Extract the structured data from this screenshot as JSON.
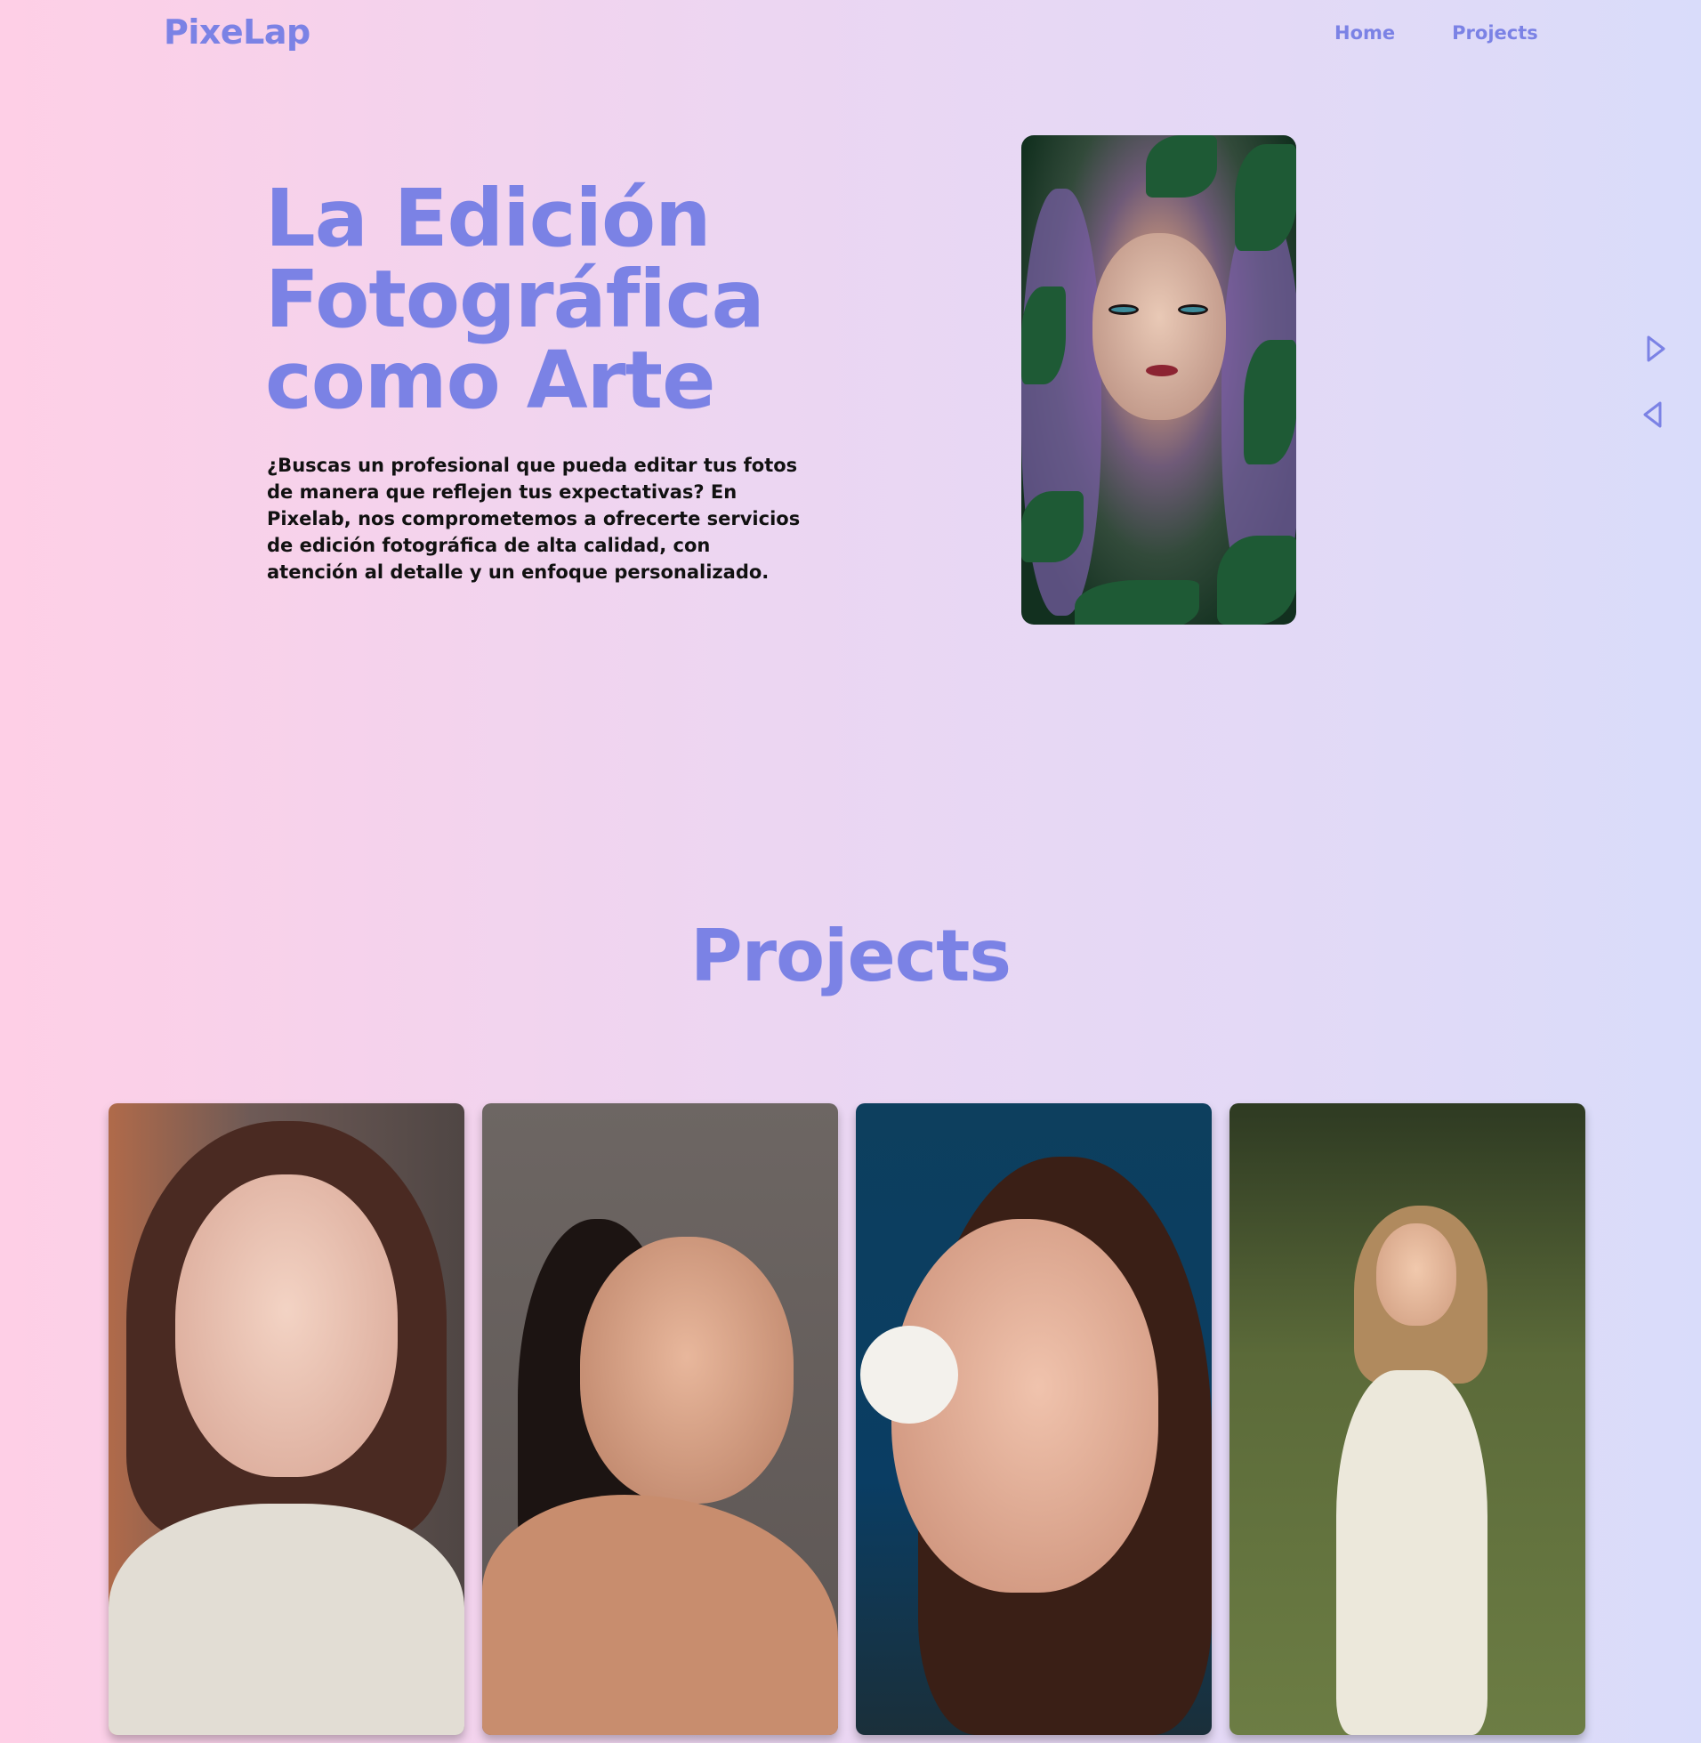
{
  "brand": {
    "logo": "PixeLap",
    "accent": "#7b82e5"
  },
  "nav": {
    "items": [
      {
        "label": "Home"
      },
      {
        "label": "Projects"
      }
    ]
  },
  "hero": {
    "title_lines": [
      "La Edición",
      "Fotográfica",
      "como Arte"
    ],
    "description": "¿Buscas un profesional que pueda editar tus fotos de manera que reflejen tus expectativas? En Pixelab, nos comprometemos a ofrecerte servicios de edición fotográfica de alta calidad, con atención al detalle y un enfoque personalizado.",
    "photo": "portrait-woman-purple-hair-leaves"
  },
  "carousel": {
    "next_icon": "triangle-right-icon",
    "prev_icon": "triangle-left-icon"
  },
  "projects": {
    "title": "Projects",
    "items": [
      {
        "photo": "portrait-woman-knit-sweater"
      },
      {
        "photo": "portrait-woman-eyes-closed"
      },
      {
        "photo": "portrait-woman-daisy-blue-background"
      },
      {
        "photo": "portrait-woman-white-dress-field"
      }
    ]
  }
}
